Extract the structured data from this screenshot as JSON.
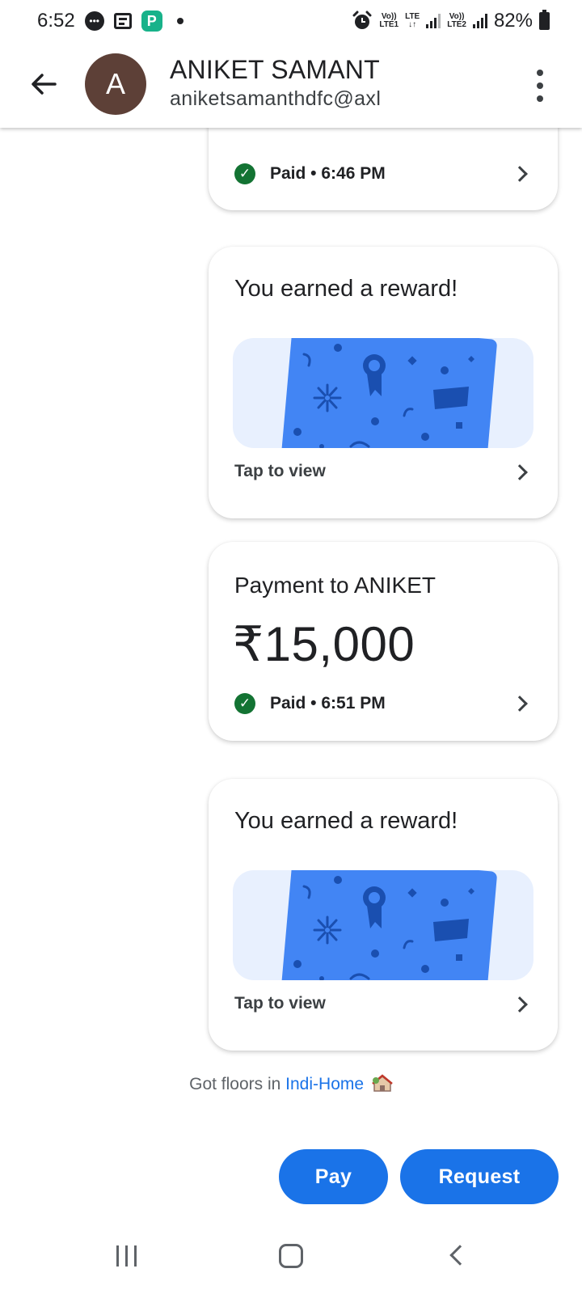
{
  "status_bar": {
    "time": "6:52",
    "battery": "82%",
    "sim1_top": "Vo))",
    "sim1_bottom": "LTE1",
    "lte_top": "LTE",
    "lte_bottom": "↓↑",
    "sim2_top": "Vo))",
    "sim2_bottom": "LTE2",
    "icons": [
      "message-icon",
      "news-icon",
      "payment-app-icon",
      "notification-dot-icon",
      "alarm-icon",
      "signal-icon",
      "signal-icon",
      "battery-icon"
    ]
  },
  "header": {
    "avatar_letter": "A",
    "avatar_color": "#5d4037",
    "contact_name": "ANIKET SAMANT",
    "contact_upi": "aniketsamanthdfc@axl"
  },
  "transactions": [
    {
      "type": "payment",
      "status": "Paid • 6:46 PM"
    },
    {
      "type": "reward",
      "title": "You earned a reward!",
      "action": "Tap to view"
    },
    {
      "type": "payment",
      "title": "Payment to ANIKET",
      "amount": "₹15,000",
      "status": "Paid • 6:51 PM"
    },
    {
      "type": "reward",
      "title": "You earned a reward!",
      "action": "Tap to view"
    }
  ],
  "footer_note": {
    "text": "Got floors in",
    "link": "Indi-Home"
  },
  "actions": {
    "pay_label": "Pay",
    "request_label": "Request"
  },
  "colors": {
    "primary": "#1a73e8",
    "success": "#137333",
    "reward_card": "#4285f4",
    "reward_bg": "#e8f0fe"
  }
}
